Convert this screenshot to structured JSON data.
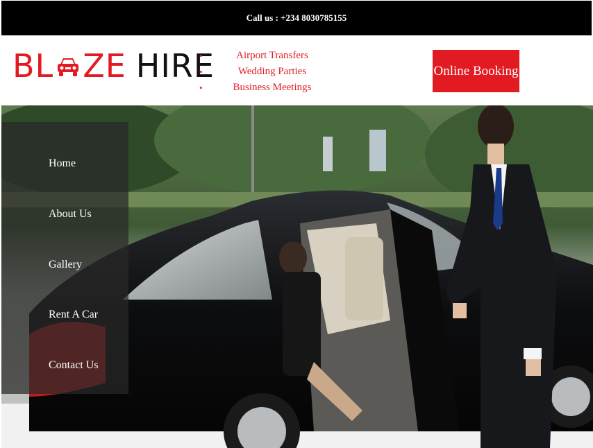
{
  "topbar": {
    "call_text": "Call us : +234 8030785155"
  },
  "brand": {
    "logo_part1": "BL",
    "logo_part2": "ZE",
    "logo_part3": "HIRE",
    "logo_icon": "car-icon",
    "accent_color": "#e21b23"
  },
  "services": [
    {
      "label": "Airport Transfers"
    },
    {
      "label": "Wedding Parties"
    },
    {
      "label": "Business Meetings"
    }
  ],
  "booking": {
    "label": "Online Booking"
  },
  "nav": [
    {
      "label": "Home"
    },
    {
      "label": "About Us"
    },
    {
      "label": "Gallery"
    },
    {
      "label": "Rent A Car"
    },
    {
      "label": "Contact Us"
    }
  ]
}
